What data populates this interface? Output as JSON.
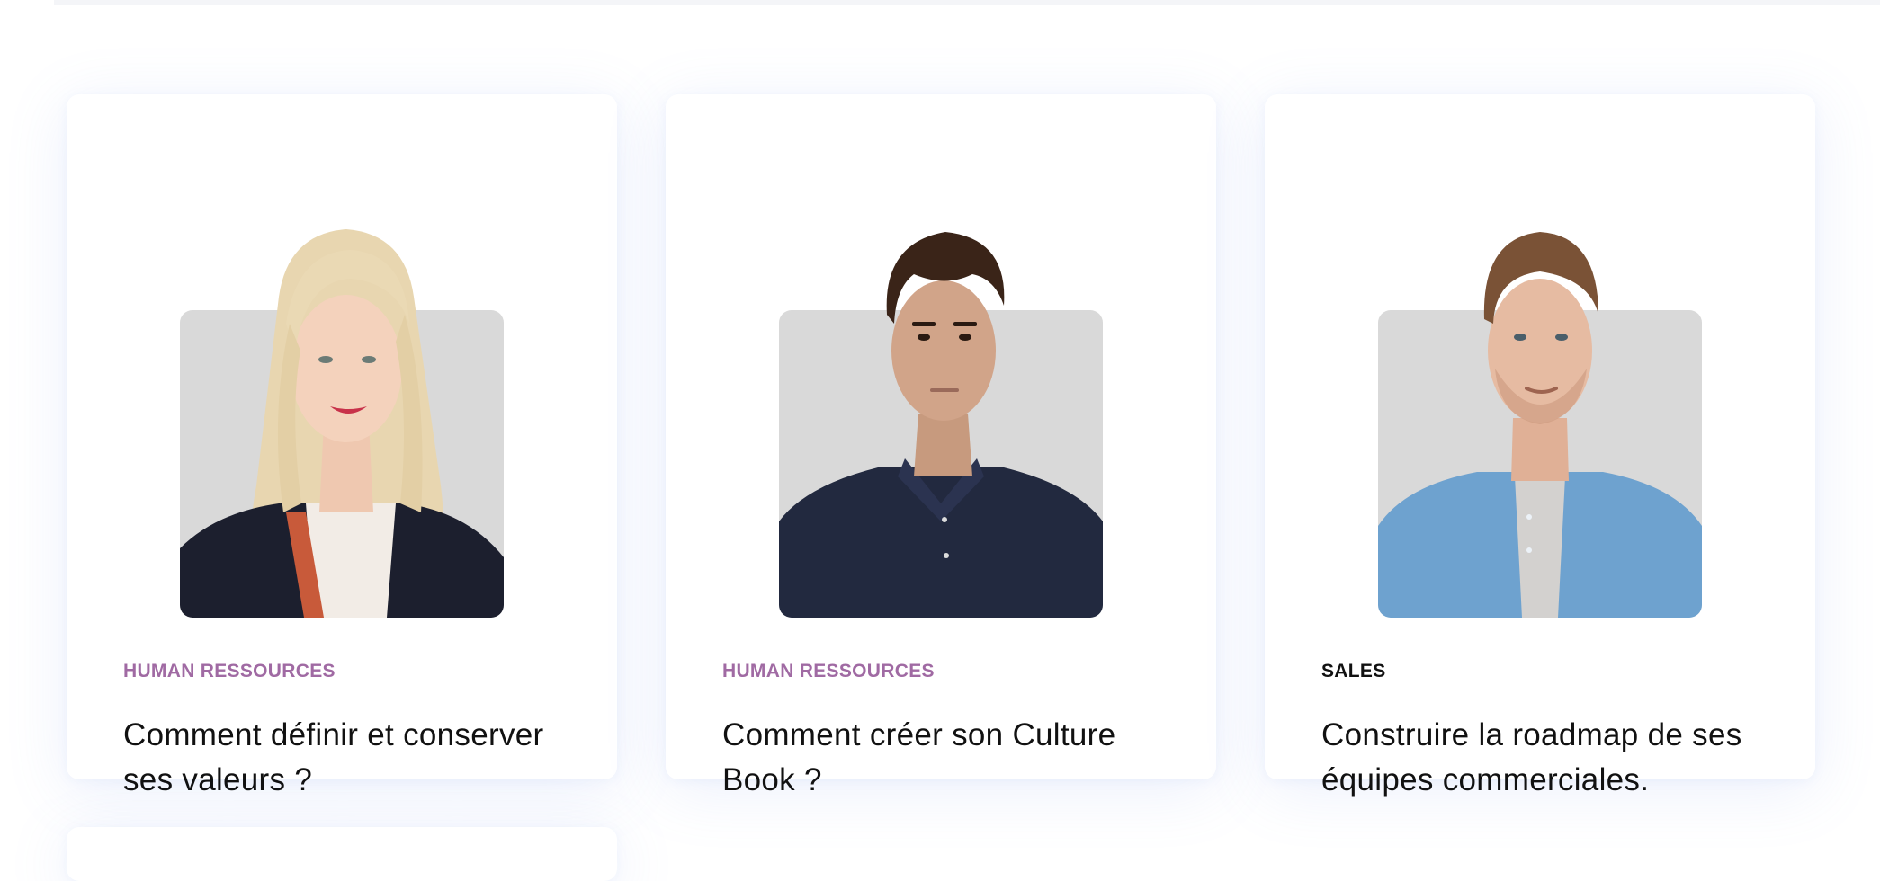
{
  "articles": [
    {
      "category": "HUMAN RESSOURCES",
      "title": "Comment définir et conserver ses valeurs ?",
      "category_color": "#a06aa3"
    },
    {
      "category": "HUMAN RESSOURCES",
      "title": "Comment créer son Culture Book ?",
      "category_color": "#a06aa3"
    },
    {
      "category": "SALES",
      "title": "Construire la roadmap de ses équipes commerciales.",
      "category_color": "#111111"
    }
  ],
  "colors": {
    "card_background": "#ffffff",
    "photo_background": "#d9d9d9",
    "accent_purple": "#a06aa3",
    "text_dark": "#111111"
  }
}
